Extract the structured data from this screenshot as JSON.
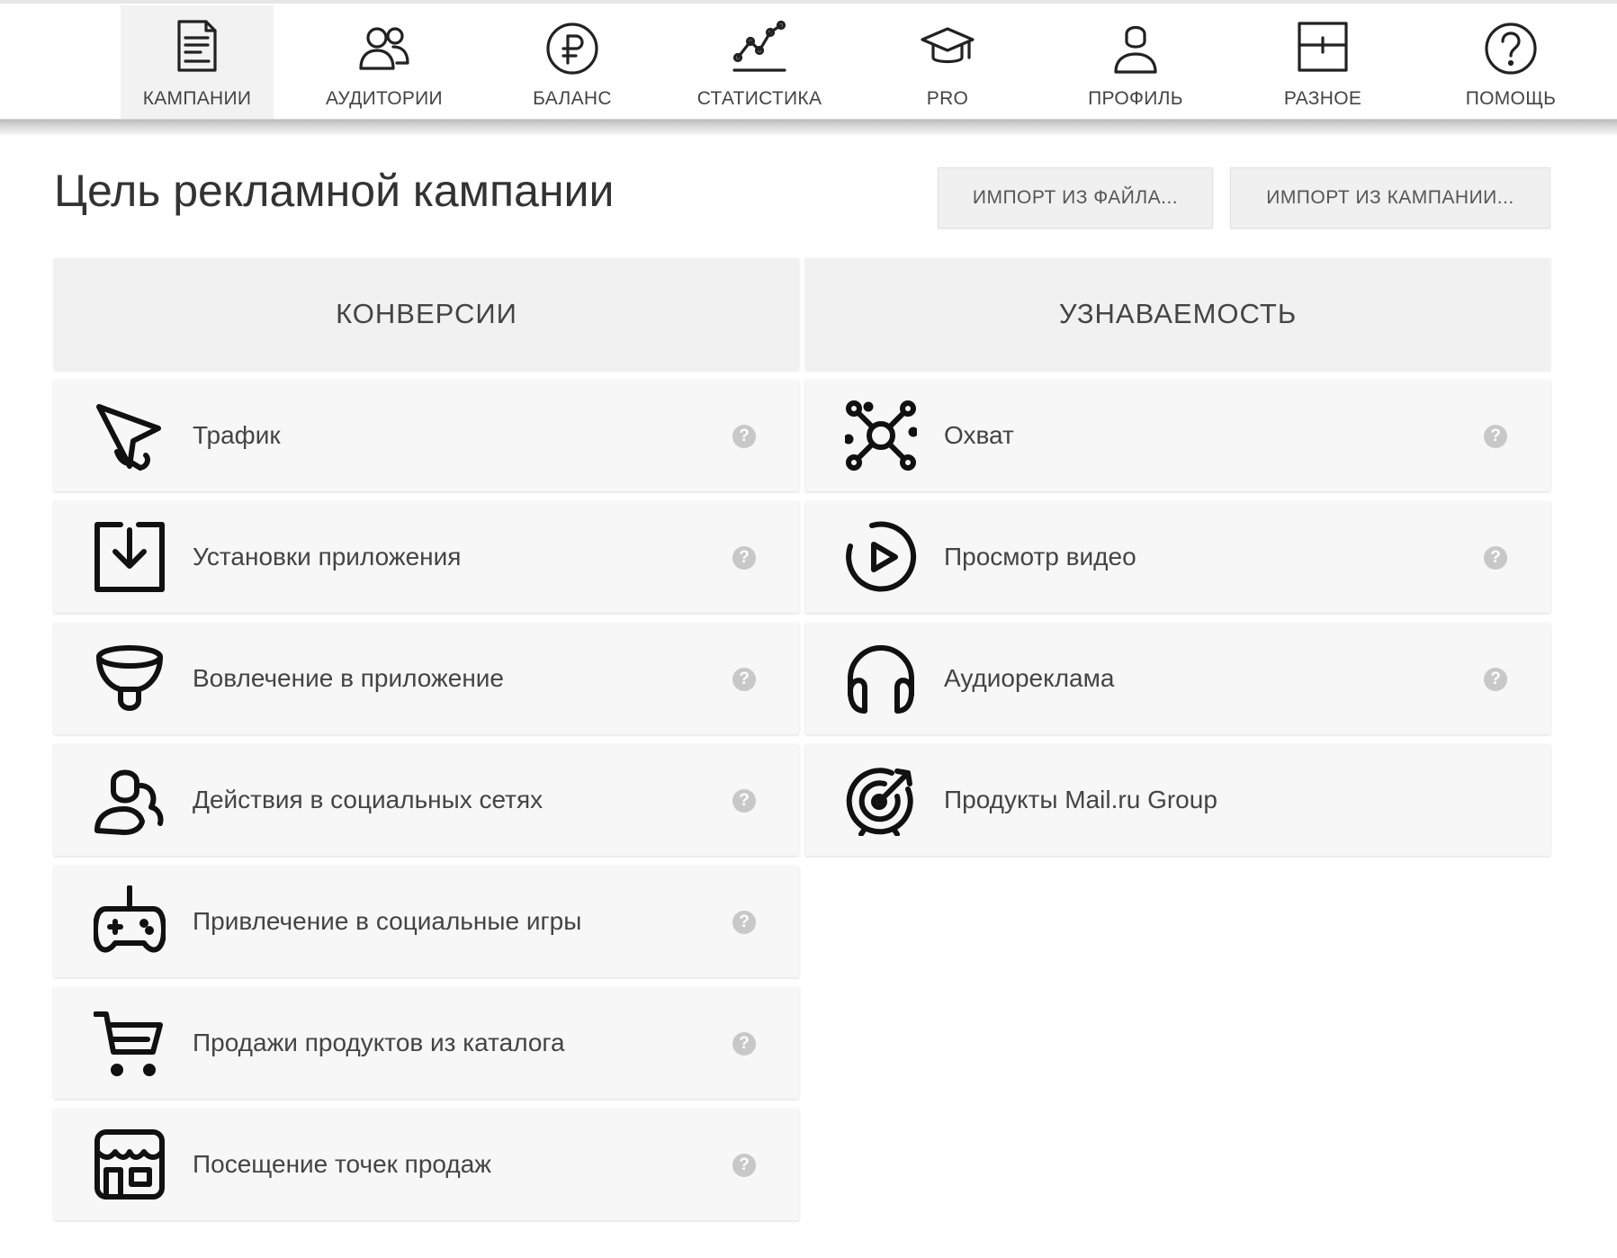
{
  "nav": {
    "items": [
      {
        "label": "КАМПАНИИ",
        "icon": "campaign-document-icon",
        "active": true
      },
      {
        "label": "АУДИТОРИИ",
        "icon": "audience-people-icon",
        "active": false
      },
      {
        "label": "БАЛАНС",
        "icon": "ruble-coin-icon",
        "active": false
      },
      {
        "label": "СТАТИСТИКА",
        "icon": "line-chart-icon",
        "active": false
      },
      {
        "label": "PRO",
        "icon": "graduation-cap-icon",
        "active": false
      },
      {
        "label": "ПРОФИЛЬ",
        "icon": "user-profile-icon",
        "active": false
      },
      {
        "label": "РАЗНОЕ",
        "icon": "misc-grid-icon",
        "active": false
      },
      {
        "label": "ПОМОЩЬ",
        "icon": "help-question-icon",
        "active": false
      }
    ]
  },
  "page": {
    "title": "Цель рекламной кампании",
    "import_file_label": "ИМПОРТ ИЗ ФАЙЛА...",
    "import_campaign_label": "ИМПОРТ ИЗ КАМПАНИИ..."
  },
  "conversions": {
    "header": "КОНВЕРСИИ",
    "options": [
      {
        "label": "Трафик",
        "icon": "cursor-click-icon"
      },
      {
        "label": "Установки приложения",
        "icon": "download-box-icon"
      },
      {
        "label": "Вовлечение в приложение",
        "icon": "funnel-icon"
      },
      {
        "label": "Действия в социальных сетях",
        "icon": "social-people-icon"
      },
      {
        "label": "Привлечение в социальные игры",
        "icon": "gamepad-icon"
      },
      {
        "label": "Продажи продуктов из каталога",
        "icon": "shopping-cart-icon"
      },
      {
        "label": "Посещение точек продаж",
        "icon": "storefront-icon"
      }
    ]
  },
  "awareness": {
    "header": "УЗНАВАЕМОСТЬ",
    "options": [
      {
        "label": "Охват",
        "icon": "reach-network-icon",
        "help": true
      },
      {
        "label": "Просмотр видео",
        "icon": "video-play-icon",
        "help": true
      },
      {
        "label": "Аудиореклама",
        "icon": "headphones-icon",
        "help": true
      },
      {
        "label": "Продукты Mail.ru Group",
        "icon": "target-arrow-icon",
        "help": false
      }
    ]
  },
  "help_glyph": "?"
}
